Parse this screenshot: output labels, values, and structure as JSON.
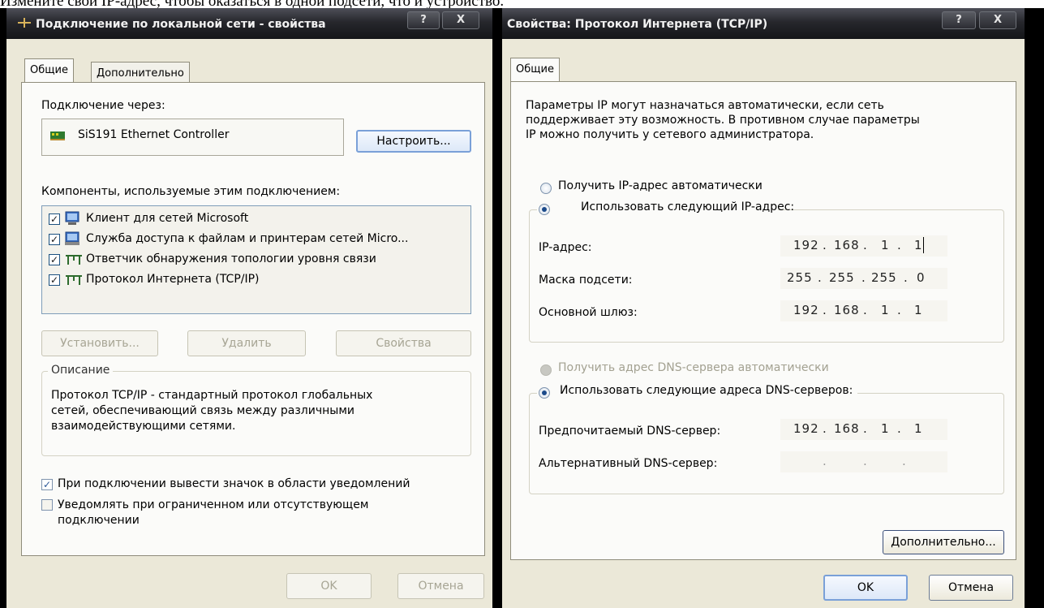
{
  "doc_text": "Измените свой IP-адрес, чтобы оказаться в одной подсети, что и устройство.",
  "left_window": {
    "title": "Подключение по локальной сети - свойства",
    "help_btn": "?",
    "close_btn": "X",
    "tabs": [
      "Общие",
      "Дополнительно"
    ],
    "connect_via_label": "Подключение через:",
    "adapter_name": "SiS191 Ethernet Controller",
    "configure_btn": "Настроить...",
    "components_label": "Компоненты, используемые этим подключением:",
    "components": [
      {
        "label": "Клиент для сетей Microsoft",
        "checked": true,
        "icon": "network-client-icon"
      },
      {
        "label": "Служба доступа к файлам и принтерам сетей Micro...",
        "checked": true,
        "icon": "file-printer-sharing-icon"
      },
      {
        "label": "Ответчик обнаружения топологии уровня связи",
        "checked": true,
        "icon": "protocol-icon"
      },
      {
        "label": "Протокол Интернета (TCP/IP)",
        "checked": true,
        "icon": "protocol-icon"
      }
    ],
    "install_btn": "Установить...",
    "remove_btn": "Удалить",
    "properties_btn": "Свойства",
    "description_title": "Описание",
    "description_text": [
      "Протокол TCP/IP - стандартный протокол глобальных",
      "сетей, обеспечивающий связь между различными",
      "взаимодействующими сетями."
    ],
    "show_icon_label": "При подключении вывести значок в области уведомлений",
    "show_icon_checked": true,
    "notify_label": [
      "Уведомлять при ограниченном или отсутствующем",
      "подключении"
    ],
    "notify_checked": false,
    "ok_btn": "OK",
    "cancel_btn": "Отмена"
  },
  "right_window": {
    "title": "Свойства: Протокол Интернета (TCP/IP)",
    "help_btn": "?",
    "close_btn": "X",
    "tab": "Общие",
    "intro": [
      "Параметры IP могут назначаться автоматически, если сеть",
      "поддерживает эту возможность. В противном случае параметры",
      "IP можно получить у сетевого администратора."
    ],
    "auto_ip_label": "Получить IP-адрес автоматически",
    "manual_ip_label": "Использовать следующий IP-адрес:",
    "ip_label": "IP-адрес:",
    "ip_value": [
      "192",
      "168",
      "1",
      "1"
    ],
    "mask_label": "Маска подсети:",
    "mask_value": [
      "255",
      "255",
      "255",
      "0"
    ],
    "gateway_label": "Основной шлюз:",
    "gateway_value": [
      "192",
      "168",
      "1",
      "1"
    ],
    "auto_dns_label": "Получить адрес DNS-сервера автоматически",
    "manual_dns_label": "Использовать следующие адреса DNS-серверов:",
    "preferred_dns_label": "Предпочитаемый DNS-сервер:",
    "preferred_dns_value": [
      "192",
      "168",
      "1",
      "1"
    ],
    "alternate_dns_label": "Альтернативный DNS-сервер:",
    "alternate_dns_value": [
      "",
      "",
      "",
      ""
    ],
    "advanced_btn": "Дополнительно...",
    "ok_btn": "OK",
    "cancel_btn": "Отмена"
  }
}
